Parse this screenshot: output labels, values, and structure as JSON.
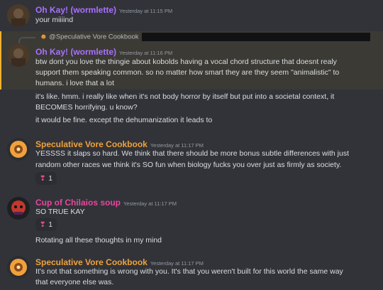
{
  "messages": [
    {
      "author": "Oh Kay! (wormlette)",
      "author_color": "#a970ff",
      "timestamp": "Yesterday at 11:15 PM",
      "lines": [
        "your miiiind"
      ]
    },
    {
      "reply_to": "@Speculative Vore Cookbook",
      "author": "Oh Kay! (wormlette)",
      "author_color": "#a970ff",
      "timestamp": "Yesterday at 11:16 PM",
      "lines": [
        "btw dont you love the thingie about kobolds having a vocal chord structure that doesnt realy",
        "support them speaking common. so no matter how smart they are they seem \"animalistic\" to",
        "humans. i love that a lot",
        "it's like. hmm. i really like when it's not body horror by itself but put into a societal context, it",
        "BECOMES horrifying. u know?",
        "it would be fine. except the dehumanization it leads to"
      ]
    },
    {
      "author": "Speculative Vore Cookbook",
      "author_color": "#f0a13c",
      "timestamp": "Yesterday at 11:17 PM",
      "lines": [
        "YESSSS it slaps so hard. We think that there should be more bonus subtle differences with just",
        "random other races we think it's SO fun when biology fucks you over just as firmly as society."
      ],
      "reaction": {
        "emoji": "heart-exclamation",
        "count": "1"
      }
    },
    {
      "author": "Cup of Chilaios soup",
      "author_color": "#eb459e",
      "timestamp": "Yesterday at 11:17 PM",
      "lines": [
        "SO TRUE KAY"
      ],
      "reaction": {
        "emoji": "heart-exclamation",
        "count": "1"
      },
      "extra_line": "Rotating all these thoughts in my mind"
    },
    {
      "author": "Speculative Vore Cookbook",
      "author_color": "#f0a13c",
      "timestamp": "Yesterday at 11:17 PM",
      "lines": [
        "It's not that something is wrong with you. It's that you weren't built for this world the same way",
        "that everyone else was."
      ]
    }
  ]
}
